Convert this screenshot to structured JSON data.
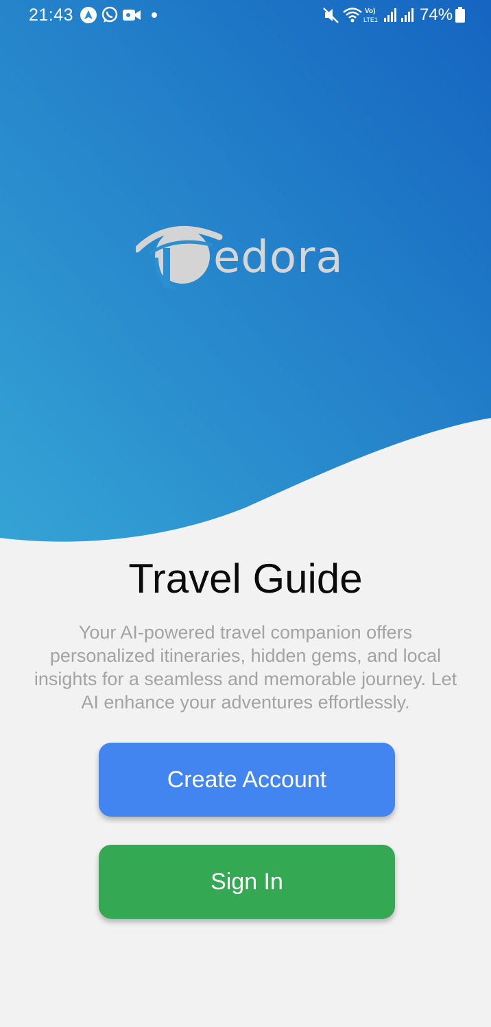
{
  "status_bar": {
    "time": "21:43",
    "battery_percent": "74%",
    "icons": [
      "navigation-icon",
      "whatsapp-icon",
      "video-call-icon",
      "mute-icon",
      "wifi-icon",
      "volte-icon",
      "signal-icon",
      "signal-icon",
      "battery-icon"
    ]
  },
  "logo": {
    "wordmark": "edora"
  },
  "main": {
    "title": "Travel Guide",
    "description": "Your AI-powered travel companion offers personalized itineraries, hidden gems, and local insights for a seamless and memorable journey. Let AI enhance your adventures effortlessly."
  },
  "buttons": {
    "create_account": "Create Account",
    "sign_in": "Sign In"
  },
  "colors": {
    "hero_gradient_start": "#2f9fd4",
    "hero_gradient_end": "#1565c0",
    "background": "#f2f2f2",
    "create_button": "#4285f0",
    "sign_in_button": "#34a853"
  }
}
